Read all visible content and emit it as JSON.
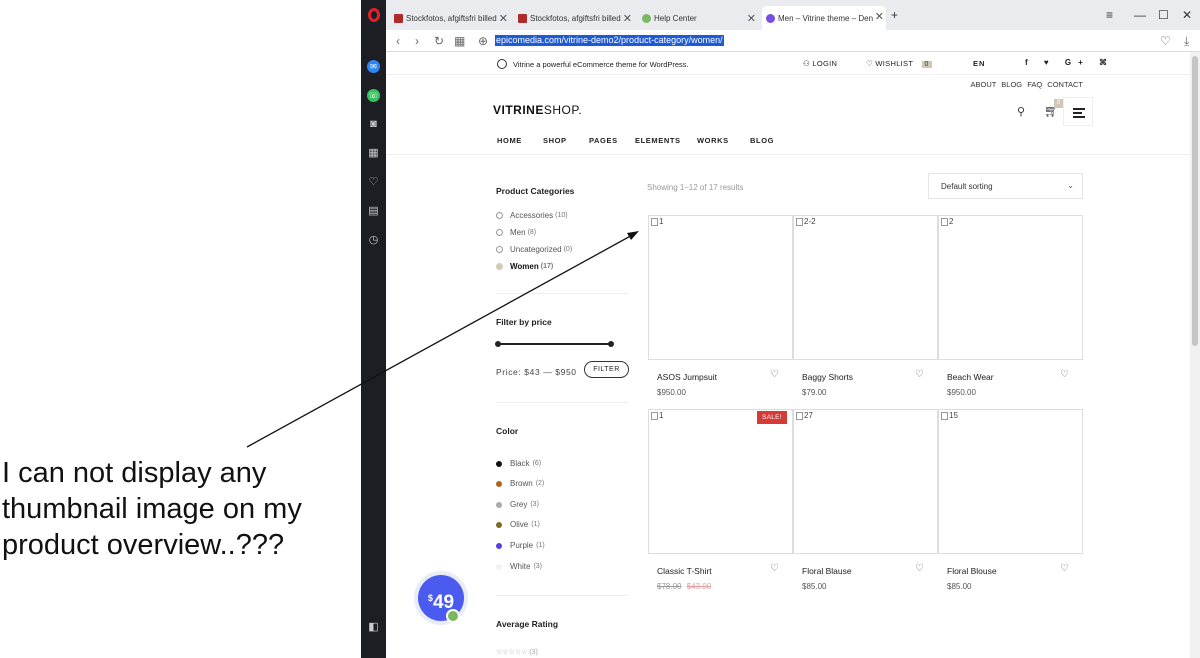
{
  "annotation": {
    "line1": "I can not display any",
    "line2": "thumbnail image on my",
    "line3": "product overview..???"
  },
  "browser": {
    "tabs": [
      {
        "title": "Stockfotos, afgiftsfri billed",
        "icon": "shutterstock-icon",
        "color": "#b12a2a"
      },
      {
        "title": "Stockfotos, afgiftsfri billed",
        "icon": "shutterstock-icon",
        "color": "#b12a2a"
      },
      {
        "title": "Help Center",
        "icon": "leaf-icon",
        "color": "#7bb661"
      },
      {
        "title": "Men – Vitrine theme – Den",
        "icon": "vitrine-icon",
        "color": "#7b4ce0"
      }
    ],
    "url": "epicomedia.com/vitrine-demo2/product-category/women/"
  },
  "site": {
    "tagline": "Vitrine a powerful eCommerce theme for WordPress.",
    "login": "LOGIN",
    "wishlist": "WISHLIST",
    "wishlist_count": "0",
    "lang": "EN",
    "social": "f ♥ G+ ⌘",
    "toplinks": "ABOUT BLOG FAQ CONTACT",
    "brand_bold": "VITRINE",
    "brand_light": "SHOP.",
    "cart_count": "0",
    "nav": [
      "HOME",
      "SHOP",
      "PAGES",
      "ELEMENTS",
      "WORKS",
      "BLOG"
    ]
  },
  "sidebar": {
    "categories_title": "Product Categories",
    "categories": [
      {
        "label": "Accessories",
        "count": "(10)"
      },
      {
        "label": "Men",
        "count": "(8)"
      },
      {
        "label": "Uncategorized",
        "count": "(0)"
      },
      {
        "label": "Women",
        "count": "(17)"
      }
    ],
    "price_title": "Filter by price",
    "price_label": "Price: $43 — $950",
    "filter_button": "FILTER",
    "color_title": "Color",
    "colors": [
      {
        "label": "Black",
        "count": "(6)",
        "swatch": "#111111"
      },
      {
        "label": "Brown",
        "count": "(2)",
        "swatch": "#b0631c"
      },
      {
        "label": "Grey",
        "count": "(3)",
        "swatch": "#aaaaaa"
      },
      {
        "label": "Olive",
        "count": "(1)",
        "swatch": "#7a6e1f"
      },
      {
        "label": "Purple",
        "count": "(1)",
        "swatch": "#5a3fd8"
      },
      {
        "label": "White",
        "count": "(3)",
        "swatch": "#f2f2f2"
      }
    ],
    "rating_title": "Average Rating",
    "rating_teaser": "(3)"
  },
  "shop": {
    "results": "Showing 1–12 of 17 results",
    "sort": "Default sorting",
    "products": [
      {
        "alt": "1",
        "name": "ASOS Jumpsuit",
        "price": "$950.00"
      },
      {
        "alt": "2-2",
        "name": "Baggy Shorts",
        "price": "$79.00"
      },
      {
        "alt": "2",
        "name": "Beach Wear",
        "price": "$950.00"
      },
      {
        "alt": "1",
        "name": "Classic T-Shirt",
        "price_old": "$78.00",
        "price": "$43.00",
        "sale": "SALE!"
      },
      {
        "alt": "27",
        "name": "Floral Blause",
        "price": "$85.00"
      },
      {
        "alt": "15",
        "name": "Floral Blouse",
        "price": "$85.00"
      }
    ]
  },
  "promo": {
    "currency": "$",
    "amount": "49"
  }
}
